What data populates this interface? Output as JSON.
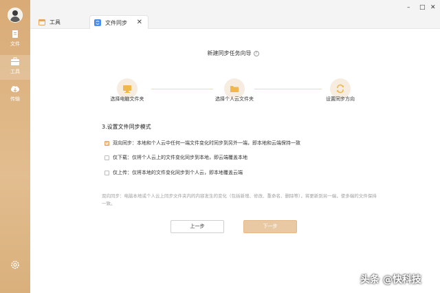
{
  "sidebar": {
    "items": [
      {
        "label": "文件",
        "icon": "file-icon"
      },
      {
        "label": "工具",
        "icon": "toolbox-icon"
      },
      {
        "label": "传输",
        "icon": "cloud-transfer-icon"
      }
    ],
    "settings_icon": "gear-icon"
  },
  "tabs": [
    {
      "label": "工具",
      "icon": "calendar-icon"
    },
    {
      "label": "文件同步",
      "icon": "sync-file-icon",
      "close": "✕"
    }
  ],
  "window_controls": {
    "minimize": "–",
    "maximize": "□",
    "close": "✕"
  },
  "wizard": {
    "title": "新建同步任务向导",
    "help": "?",
    "steps": [
      {
        "label": "选择电脑文件夹",
        "icon": "monitor-icon"
      },
      {
        "label": "选择个人云文件夹",
        "icon": "folder-icon"
      },
      {
        "label": "设置同步方向",
        "icon": "sync-icon"
      }
    ],
    "section_title": "3.设置文件同步模式",
    "options": [
      {
        "label": "双向同步：本地和个人云中任何一端文件变化时同步到另外一端，即本地和云端保持一致",
        "checked": true
      },
      {
        "label": "仅下载：仅将个人云上的文件变化同步到本地，即云端覆盖本地",
        "checked": false
      },
      {
        "label": "仅上传：仅将本地的文件变化同步到个人云，即本地覆盖云端",
        "checked": false
      }
    ],
    "description": "双向同步：电脑本地或个人云上同步文件夹内的内容发生的变化（包括新增、修改、重命名、删除等），将更新到另一端，使多端的文件保持一致。",
    "prev_button": "上一步",
    "next_button": "下一步"
  },
  "watermark": "头条 @快科技",
  "colors": {
    "accent": "#e8c9a3",
    "sidebar": "#d9ab76",
    "step_bg": "#f6ecdf",
    "step_icon": "#f0b74d"
  }
}
